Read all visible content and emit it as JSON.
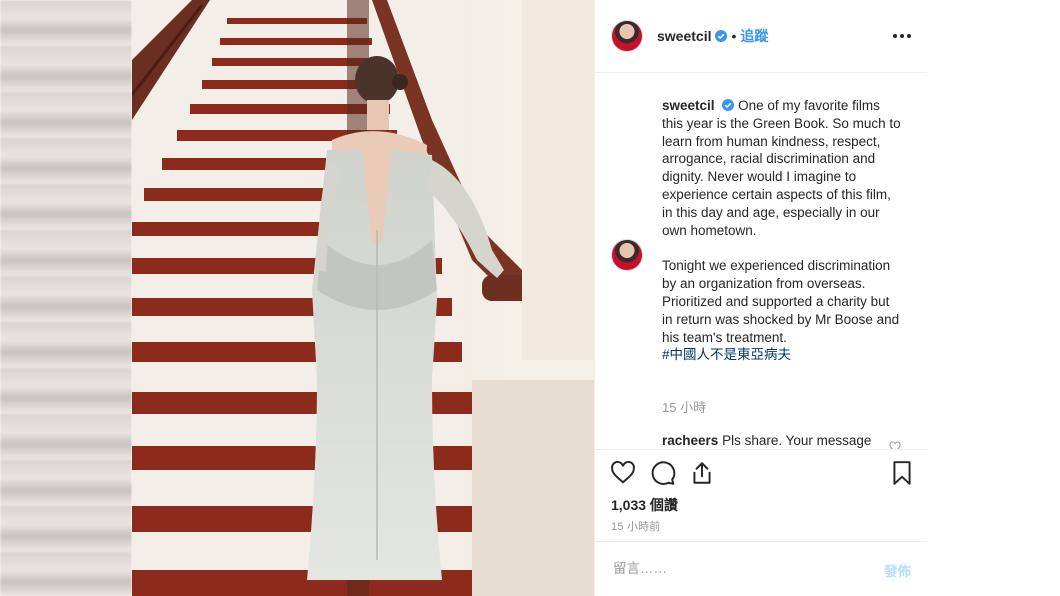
{
  "header": {
    "username": "sweetcil",
    "separator": "•",
    "follow_label": "追蹤"
  },
  "caption": {
    "username": "sweetcil",
    "paragraph1": "One of my favorite films this year is the Green Book. So much to learn from human kindness, respect, arrogance, racial discrimination and dignity. Never would I imagine to experience certain aspects of this film, in this day and age, especially in our own hometown.",
    "paragraph2": "Tonight we experienced discrimination by an organization from overseas. Prioritized and supported a charity but in return was shocked by Mr Boose and his team's treatment.",
    "hashtag": "#中國人不是東亞病夫",
    "time": "15 小時"
  },
  "reply": {
    "username": "racheers",
    "text": "Pls share. Your message"
  },
  "actions": {
    "likes": "1,033 個讚",
    "posted": "15 小時前"
  },
  "comment": {
    "placeholder": "留言……",
    "post_label": "發佈"
  },
  "colors": {
    "link": "#3897f0",
    "hashtag": "#003569",
    "muted": "#999999",
    "post_disabled": "#b2dffc"
  },
  "icons": [
    "verified-badge-icon",
    "more-options-icon",
    "heart-icon",
    "comment-icon",
    "share-icon",
    "bookmark-icon"
  ]
}
